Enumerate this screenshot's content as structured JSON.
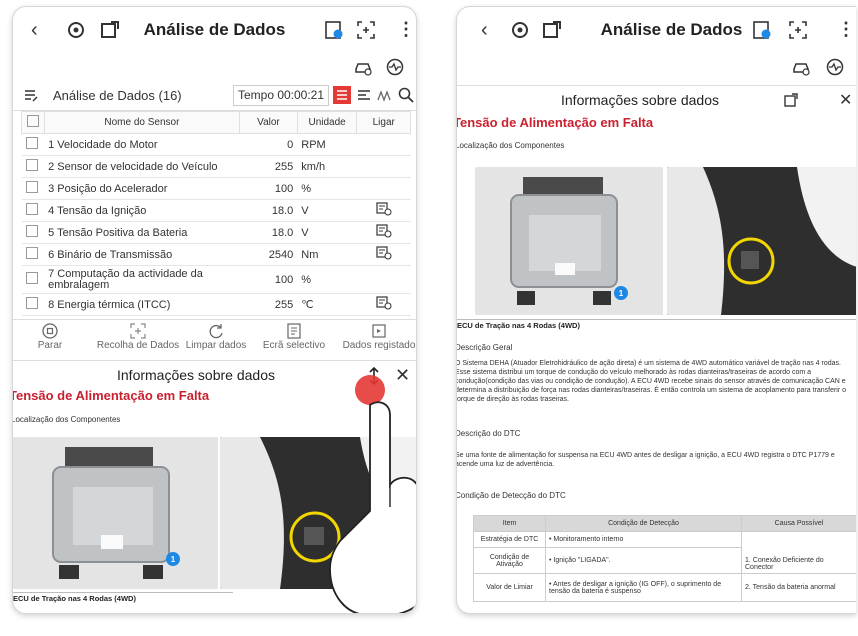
{
  "app": {
    "title": "Análise de Dados"
  },
  "left": {
    "list_title": "Análise de Dados (16)",
    "timer": "Tempo 00:00:21",
    "table": {
      "headers": [
        "Nome do Sensor",
        "Valor",
        "Unidade",
        "Ligar"
      ],
      "rows": [
        {
          "name": "1 Velocidade do Motor",
          "value": "0",
          "unit": "RPM",
          "link": false
        },
        {
          "name": "2 Sensor de velocidade do Veículo",
          "value": "255",
          "unit": "km/h",
          "link": false
        },
        {
          "name": "3 Posição do Acelerador",
          "value": "100",
          "unit": "%",
          "link": false
        },
        {
          "name": "4 Tensão da Ignição",
          "value": "18.0",
          "unit": "V",
          "link": true
        },
        {
          "name": "5 Tensão Positiva da Bateria",
          "value": "18.0",
          "unit": "V",
          "link": true
        },
        {
          "name": "6 Binário de Transmissão",
          "value": "2540",
          "unit": "Nm",
          "link": true
        },
        {
          "name": "7 Computação da actividade da embralagem",
          "value": "100",
          "unit": "%",
          "link": false
        },
        {
          "name": "8 Energia térmica (ITCC)",
          "value": "255",
          "unit": "℃",
          "link": true
        }
      ]
    },
    "toolbar": [
      "Parar",
      "Recolha de Dados",
      "Limpar dados",
      "Ecrã selectivo",
      "Dados registado"
    ],
    "panel_title": "Informações sobre dados",
    "section_title": "Tensão de Alimentação em Falta",
    "components_label": "Localização dos Componentes",
    "caption": "ECU de Tração nas 4 Rodas (4WD)",
    "marker": "1"
  },
  "right": {
    "panel_title": "Informações sobre dados",
    "section_title": "Tensão de Alimentação em Falta",
    "components_label": "Localização dos Componentes",
    "caption": "ECU de Tração nas 4 Rodas (4WD)",
    "marker": "1",
    "general_heading": "Descrição Geral",
    "general_text": "O Sistema DEHA (Atuador Eletrohidráulico de ação direta) é um sistema de 4WD automático variável de tração nas 4 rodas. Esse sistema distribui um torque de condução do veículo melhorado às rodas dianteiras/traseiras de acordo com a condução(condição das vias ou condição de condução). A ECU 4WD recebe sinais do sensor através de comunicação CAN e determina a distribuição de força nas rodas dianteiras/traseiras. É então controla um sistema de acoplamento para transferir o torque de direção às rodas traseiras.",
    "dtc_heading": "Descrição do DTC",
    "dtc_text": "Se uma fonte de alimentação for suspensa na ECU 4WD antes de desligar a ignição, a ECU 4WD registra o DTC P1779 e acende uma luz de advertência.",
    "detect_heading": "Condição de Detecção do DTC",
    "dtc_table": {
      "headers": [
        "Item",
        "Condição de Detecção",
        "Causa Possível"
      ],
      "rows": [
        [
          "Estratégia de DTC",
          "• Monitoramento interno"
        ],
        [
          "Condição de Ativação",
          "• Ignição \"LIGADA\"."
        ],
        [
          "Valor de Limiar",
          "• Antes de desligar a ignição (IG OFF), o suprimento de tensão da bateria é suspenso"
        ]
      ],
      "causes": [
        "1. Conexão Deficiente do Conector",
        "2. Tensão da bateria anormal"
      ]
    }
  },
  "colors": {
    "accent_red": "#c8212f",
    "highlight_yellow": "#f2d600",
    "marker_blue": "#1e88e5"
  }
}
